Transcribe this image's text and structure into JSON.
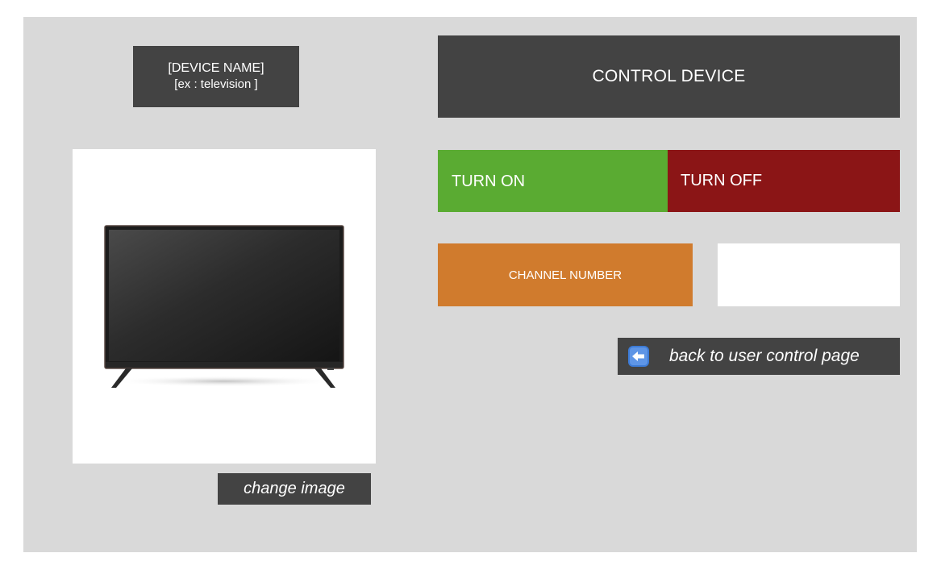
{
  "device": {
    "name_label": "[DEVICE NAME]",
    "name_example": "[ex : television ]",
    "change_image_label": "change image",
    "image_icon": "television-image"
  },
  "control": {
    "title": "CONTROL DEVICE",
    "turn_on_label": "TURN ON",
    "turn_off_label": "TURN OFF",
    "channel_label": "CHANNEL NUMBER",
    "channel_value": ""
  },
  "navigation": {
    "back_label": "back to user control page",
    "back_icon": "left-arrow-icon"
  },
  "colors": {
    "panel_bg": "#d9d9d9",
    "dark_box": "#434343",
    "turn_on": "#5aab32",
    "turn_off": "#8b1516",
    "channel": "#d07b2d",
    "arrow_blue": "#3d7bd6"
  }
}
